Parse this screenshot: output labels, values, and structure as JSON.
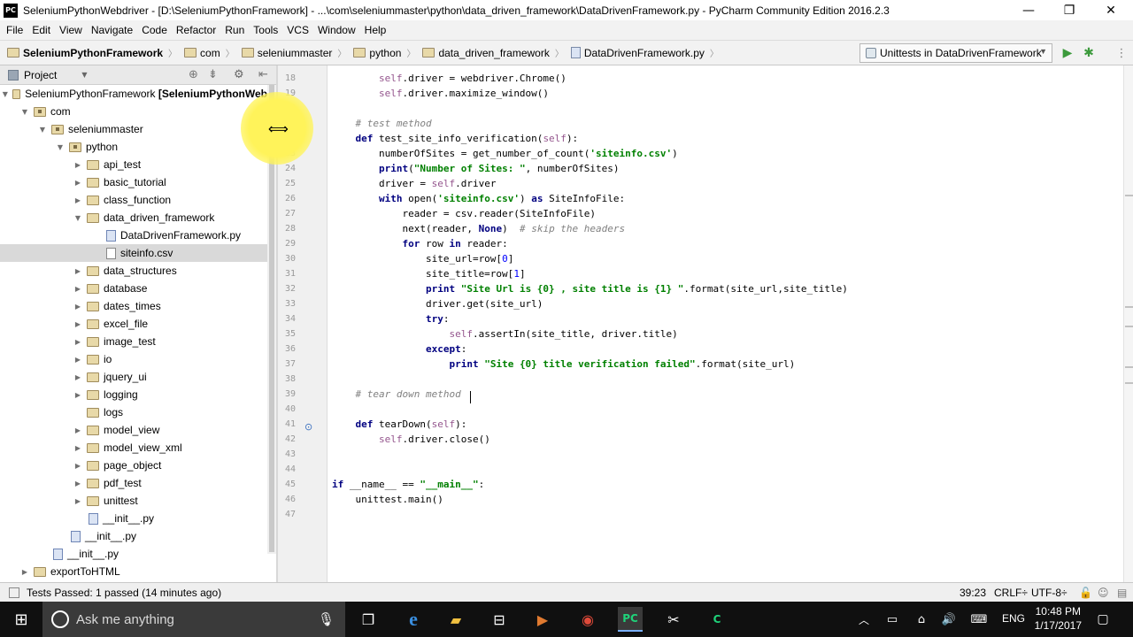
{
  "window": {
    "app_icon": "PC",
    "title": "SeleniumPythonWebdriver - [D:\\SeleniumPythonFramework] - ...\\com\\seleniummaster\\python\\data_driven_framework\\DataDrivenFramework.py - PyCharm Community Edition 2016.2.3",
    "minimize": "—",
    "maximize": "❐",
    "close": "✕"
  },
  "menu": [
    "File",
    "Edit",
    "View",
    "Navigate",
    "Code",
    "Refactor",
    "Run",
    "Tools",
    "VCS",
    "Window",
    "Help"
  ],
  "breadcrumbs": [
    "SeleniumPythonFramework",
    "com",
    "seleniummaster",
    "python",
    "data_driven_framework",
    "DataDrivenFramework.py"
  ],
  "run_config": {
    "label": "Unittests in DataDrivenFramework"
  },
  "project_panel": {
    "title": "Project"
  },
  "tree": [
    {
      "label": "SeleniumPythonFramework [SeleniumPythonWeb",
      "indent": 0,
      "type": "folder",
      "expanded": true
    },
    {
      "label": "com",
      "indent": 1,
      "type": "package",
      "expanded": true
    },
    {
      "label": "seleniummaster",
      "indent": 2,
      "type": "package",
      "expanded": true
    },
    {
      "label": "python",
      "indent": 3,
      "type": "package",
      "expanded": true
    },
    {
      "label": "api_test",
      "indent": 4,
      "type": "folder",
      "expanded": false
    },
    {
      "label": "basic_tutorial",
      "indent": 4,
      "type": "folder",
      "expanded": false
    },
    {
      "label": "class_function",
      "indent": 4,
      "type": "folder",
      "expanded": false
    },
    {
      "label": "data_driven_framework",
      "indent": 4,
      "type": "folder",
      "expanded": true
    },
    {
      "label": "DataDrivenFramework.py",
      "indent": 5,
      "type": "py"
    },
    {
      "label": "siteinfo.csv",
      "indent": 5,
      "type": "csv",
      "selected": true
    },
    {
      "label": "data_structures",
      "indent": 4,
      "type": "folder",
      "expanded": false
    },
    {
      "label": "database",
      "indent": 4,
      "type": "folder",
      "expanded": false
    },
    {
      "label": "dates_times",
      "indent": 4,
      "type": "folder",
      "expanded": false
    },
    {
      "label": "excel_file",
      "indent": 4,
      "type": "folder",
      "expanded": false
    },
    {
      "label": "image_test",
      "indent": 4,
      "type": "folder",
      "expanded": false
    },
    {
      "label": "io",
      "indent": 4,
      "type": "folder",
      "expanded": false
    },
    {
      "label": "jquery_ui",
      "indent": 4,
      "type": "folder",
      "expanded": false
    },
    {
      "label": "logging",
      "indent": 4,
      "type": "folder",
      "expanded": false
    },
    {
      "label": "logs",
      "indent": 4,
      "type": "folder",
      "leaf": true
    },
    {
      "label": "model_view",
      "indent": 4,
      "type": "folder",
      "expanded": false
    },
    {
      "label": "model_view_xml",
      "indent": 4,
      "type": "folder",
      "expanded": false
    },
    {
      "label": "page_object",
      "indent": 4,
      "type": "folder",
      "expanded": false
    },
    {
      "label": "pdf_test",
      "indent": 4,
      "type": "folder",
      "expanded": false
    },
    {
      "label": "unittest",
      "indent": 4,
      "type": "folder",
      "expanded": false
    },
    {
      "label": "__init__.py",
      "indent": 4,
      "type": "py"
    },
    {
      "label": "__init__.py",
      "indent": 3,
      "type": "py"
    },
    {
      "label": "__init__.py",
      "indent": 2,
      "type": "py"
    },
    {
      "label": "exportToHTML",
      "indent": 1,
      "type": "folder",
      "expanded": false
    }
  ],
  "code_lines": [
    {
      "num": "18",
      "html": "        <span class=\"sf\">self</span>.driver = webdriver.Chrome()"
    },
    {
      "num": "19",
      "html": "        <span class=\"sf\">self</span>.driver.maximize_window()"
    },
    {
      "num": "20",
      "html": ""
    },
    {
      "num": "21",
      "html": "    <span class=\"c\"># test method</span>"
    },
    {
      "num": "22",
      "html": "    <span class=\"k\">def</span> test_site_info_verification(<span class=\"sf\">self</span>):"
    },
    {
      "num": "23",
      "html": "        numberOfSites = get_number_of_count(<span class=\"s\">'siteinfo.csv'</span>)"
    },
    {
      "num": "24",
      "html": "        <span class=\"k\">print</span>(<span class=\"s\">\"Number of Sites: \"</span>, numberOfSites)"
    },
    {
      "num": "25",
      "html": "        driver = <span class=\"sf\">self</span>.driver"
    },
    {
      "num": "26",
      "html": "        <span class=\"k\">with</span> open(<span class=\"s\">'siteinfo.csv'</span>) <span class=\"k\">as</span> SiteInfoFile:"
    },
    {
      "num": "27",
      "html": "            reader = csv.reader(SiteInfoFile)"
    },
    {
      "num": "28",
      "html": "            next(reader, <span class=\"k\">None</span>)  <span class=\"c\"># skip the headers</span>"
    },
    {
      "num": "29",
      "html": "            <span class=\"k\">for</span> row <span class=\"k\">in</span> reader:"
    },
    {
      "num": "30",
      "html": "                site_url=row[<span class=\"n\">0</span>]"
    },
    {
      "num": "31",
      "html": "                site_title=row[<span class=\"n\">1</span>]"
    },
    {
      "num": "32",
      "html": "                <span class=\"k\">print</span> <span class=\"s\">\"Site Url is {0} , site title is {1} \"</span>.format(site_url,site_title)"
    },
    {
      "num": "33",
      "html": "                driver.get(site_url)"
    },
    {
      "num": "34",
      "html": "                <span class=\"k\">try</span>:"
    },
    {
      "num": "35",
      "html": "                    <span class=\"sf\">self</span>.assertIn(site_title, driver.title)"
    },
    {
      "num": "36",
      "html": "                <span class=\"k\">except</span>:"
    },
    {
      "num": "37",
      "html": "                    <span class=\"k\">print</span> <span class=\"s\">\"Site {0} title verification failed\"</span>.format(site_url)"
    },
    {
      "num": "38",
      "html": ""
    },
    {
      "num": "39",
      "html": "    <span class=\"c\"># tear down method</span>"
    },
    {
      "num": "40",
      "html": ""
    },
    {
      "num": "41",
      "html": "    <span class=\"k\">def</span> tearDown(<span class=\"sf\">self</span>):"
    },
    {
      "num": "42",
      "html": "        <span class=\"sf\">self</span>.driver.close()"
    },
    {
      "num": "43",
      "html": ""
    },
    {
      "num": "44",
      "html": ""
    },
    {
      "num": "45",
      "html": "<span class=\"k\">if</span> __name__ == <span class=\"s\">\"__main__\"</span>:"
    },
    {
      "num": "46",
      "html": "    unittest.main()"
    },
    {
      "num": "47",
      "html": ""
    }
  ],
  "status": {
    "message": "Tests Passed: 1 passed (14 minutes ago)",
    "position": "39:23",
    "line_sep": "CRLF÷",
    "encoding": "UTF-8÷"
  },
  "taskbar": {
    "search_placeholder": "Ask me anything",
    "language": "ENG",
    "time": "10:48 PM",
    "date": "1/17/2017"
  }
}
